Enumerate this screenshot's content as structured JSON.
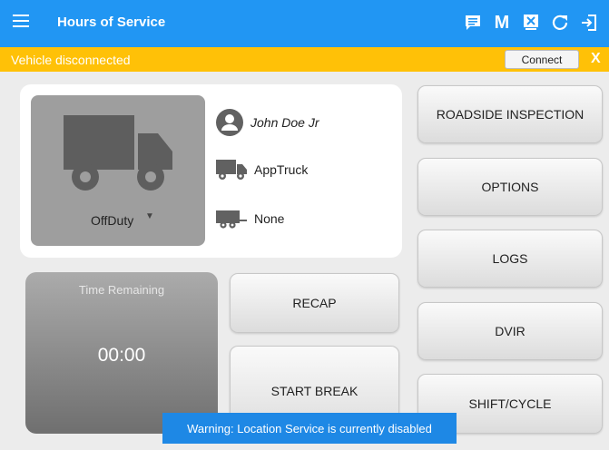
{
  "header": {
    "title": "Hours of Service",
    "icons": [
      "menu-icon",
      "message-icon",
      "m-icon",
      "certify-icon",
      "refresh-icon",
      "logout-icon"
    ],
    "m_label": "M"
  },
  "banner": {
    "text": "Vehicle disconnected",
    "connect_label": "Connect",
    "close_label": "X"
  },
  "status": {
    "duty_status": "OffDuty",
    "driver": "John Doe Jr",
    "vehicle": "AppTruck",
    "trailer": "None"
  },
  "time_remaining": {
    "label": "Time Remaining",
    "value": "00:00"
  },
  "middle_buttons": {
    "recap": "RECAP",
    "start_break": "START BREAK"
  },
  "right_buttons": {
    "roadside": "ROADSIDE INSPECTION",
    "options": "OPTIONS",
    "logs": "LOGS",
    "dvir": "DVIR",
    "shift_cycle": "SHIFT/CYCLE"
  },
  "toast": {
    "text": "Warning: Location Service is currently disabled"
  },
  "colors": {
    "topbar": "#2196f3",
    "banner": "#ffc107",
    "toast": "#1e88e5"
  }
}
